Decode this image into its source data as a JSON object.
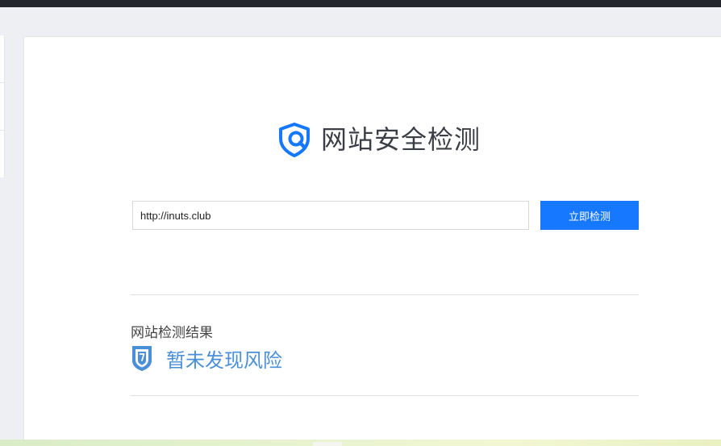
{
  "header": {
    "title": "网站安全检测"
  },
  "search": {
    "url_value": "http://inuts.club",
    "button_label": "立即检测"
  },
  "result": {
    "heading": "网站检测结果",
    "status": "暂未发现风险"
  },
  "icons": {
    "logo": "shield-magnifier-icon",
    "result": "shield-checked-icon"
  },
  "colors": {
    "accent": "#1677ff",
    "result_text": "#4a8fd8",
    "title_text": "#3b3e46"
  }
}
